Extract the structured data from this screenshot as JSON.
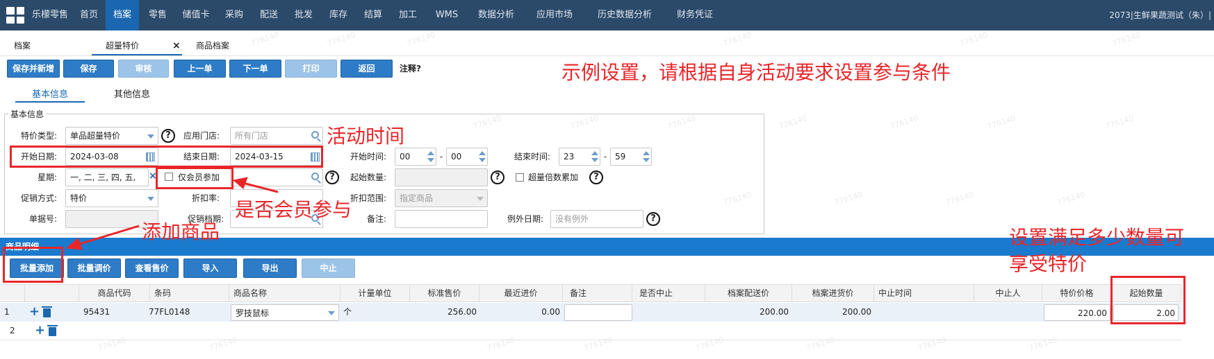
{
  "nav": {
    "brand": "乐檬零售",
    "items": [
      "首页",
      "档案",
      "零售",
      "储值卡",
      "采购",
      "配送",
      "批发",
      "库存",
      "结算",
      "加工",
      "WMS",
      "数据分析",
      "应用市场",
      "历史数据分析",
      "财务凭证"
    ],
    "active_index": 1,
    "user": "2073|生鲜果蔬测试（朱）|"
  },
  "page_tabs": {
    "tab1": "档案",
    "tab2": "超量特价",
    "tab2_close": "×",
    "tab3": "商品档案"
  },
  "toolbar": {
    "save_new": "保存并新增",
    "save": "保存",
    "audit": "审核",
    "prev": "上一单",
    "next": "下一单",
    "print": "打印",
    "back": "返回",
    "note": "注释?"
  },
  "subtabs": {
    "basic": "基本信息",
    "other": "其他信息"
  },
  "form": {
    "legend": "基本信息",
    "price_type_label": "特价类型:",
    "price_type_value": "单品超量特价",
    "store_label": "应用门店:",
    "store_placeholder": "所有门店",
    "start_date_label": "开始日期:",
    "start_date_value": "2024-03-08",
    "end_date_label": "结束日期:",
    "end_date_value": "2024-03-15",
    "start_time_label": "开始时间:",
    "start_hour": "00",
    "start_min": "00",
    "end_time_label": "结束时间:",
    "end_hour": "23",
    "end_min": "59",
    "time_sep": "-",
    "week_label": "星期:",
    "week_value": "一, 二, 三, 四, 五,",
    "clear": "×",
    "member_only": "仅会员参加",
    "start_qty_label": "起始数量:",
    "multiple_label": "超量倍数累加",
    "promo_label": "促销方式:",
    "promo_value": "特价",
    "discount_label": "折扣率:",
    "discount_range_label": "折扣范围:",
    "discount_range_value": "指定商品",
    "order_no_label": "单据号:",
    "promo_level_label": "促销档期:",
    "remark_label": "备注:",
    "except_label": "例外日期:",
    "except_placeholder": "没有例外",
    "help": "?"
  },
  "product_section": {
    "title": "商品明细",
    "batch_add": "批量添加",
    "batch_adjust": "批量调价",
    "view_price": "查看售价",
    "import": "导入",
    "export": "导出",
    "stop": "中止"
  },
  "grid": {
    "headers": [
      "商品代码",
      "条码",
      "商品名称",
      "计量单位",
      "标准售价",
      "最近进价",
      "备注",
      "是否中止",
      "档案配送价",
      "档案进货价",
      "中止时间",
      "中止人",
      "特价价格",
      "起始数量"
    ],
    "rows": [
      {
        "no": "1",
        "code": "95431",
        "barcode": "77FL0148",
        "name": "罗技鼠标",
        "unit": "个",
        "std_price": "256.00",
        "last_price": "0.00",
        "ship_price": "200.00",
        "purchase_price": "200.00",
        "special_price": "220.00",
        "start_qty": "2.00"
      },
      {
        "no": "2"
      }
    ]
  },
  "annotations": {
    "headline": "示例设置，请根据自身活动要求设置参与条件",
    "activity_time": "活动时间",
    "member": "是否会员参与",
    "add_goods": "添加商品",
    "qty_line1": "设置满足多少数量可",
    "qty_line2": "享受特价"
  },
  "watermark": "776140",
  "colors": {
    "nav_bg": "#2b4a6a",
    "nav_active": "#1a67b0",
    "button": "#2e7cc7",
    "annotation": "#e8262a",
    "section_bar": "#1a7acd"
  }
}
